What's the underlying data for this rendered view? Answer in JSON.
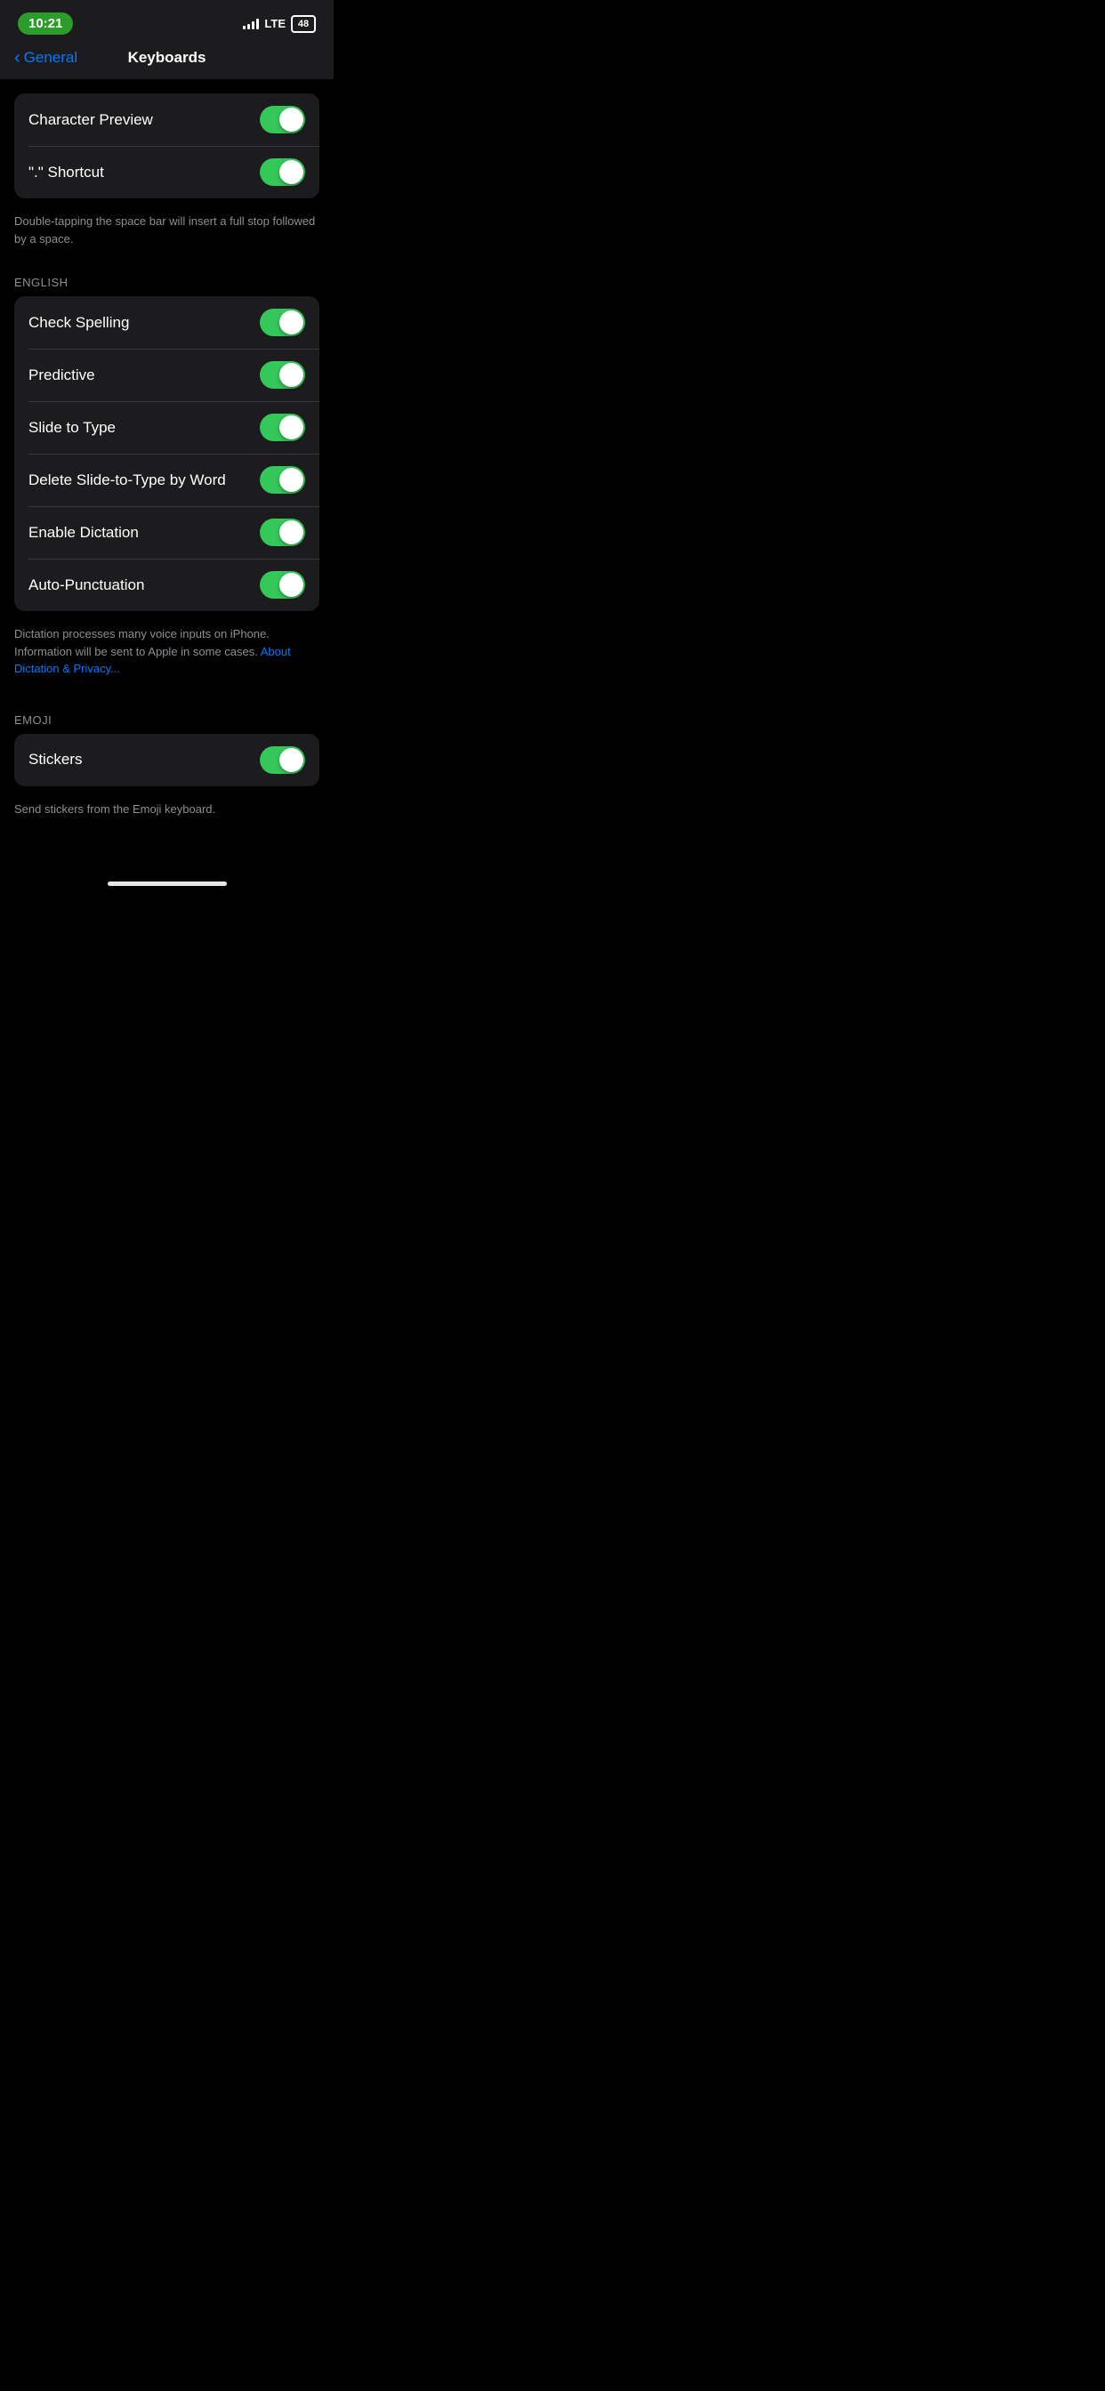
{
  "status": {
    "time": "10:21",
    "lte": "LTE",
    "battery": "48"
  },
  "nav": {
    "back_label": "General",
    "title": "Keyboards"
  },
  "sections": {
    "top_group": {
      "rows": [
        {
          "id": "character-preview",
          "label": "Character Preview",
          "toggle": true
        },
        {
          "id": "period-shortcut",
          "label": "\".\" Shortcut",
          "toggle": true
        }
      ],
      "footer": "Double-tapping the space bar will insert a full stop followed by a space."
    },
    "english_group": {
      "section_label": "ENGLISH",
      "rows": [
        {
          "id": "check-spelling",
          "label": "Check Spelling",
          "toggle": true
        },
        {
          "id": "predictive",
          "label": "Predictive",
          "toggle": true
        },
        {
          "id": "slide-to-type",
          "label": "Slide to Type",
          "toggle": true
        },
        {
          "id": "delete-slide-type",
          "label": "Delete Slide-to-Type by Word",
          "toggle": true
        },
        {
          "id": "enable-dictation",
          "label": "Enable Dictation",
          "toggle": true
        },
        {
          "id": "auto-punctuation",
          "label": "Auto-Punctuation",
          "toggle": true
        }
      ],
      "footer_text": "Dictation processes many voice inputs on iPhone. Information will be sent to Apple in some cases. ",
      "footer_link": "About Dictation & Privacy...",
      "footer_link_url": "#"
    },
    "emoji_group": {
      "section_label": "EMOJI",
      "rows": [
        {
          "id": "stickers",
          "label": "Stickers",
          "toggle": true
        }
      ],
      "footer": "Send stickers from the Emoji keyboard."
    }
  }
}
